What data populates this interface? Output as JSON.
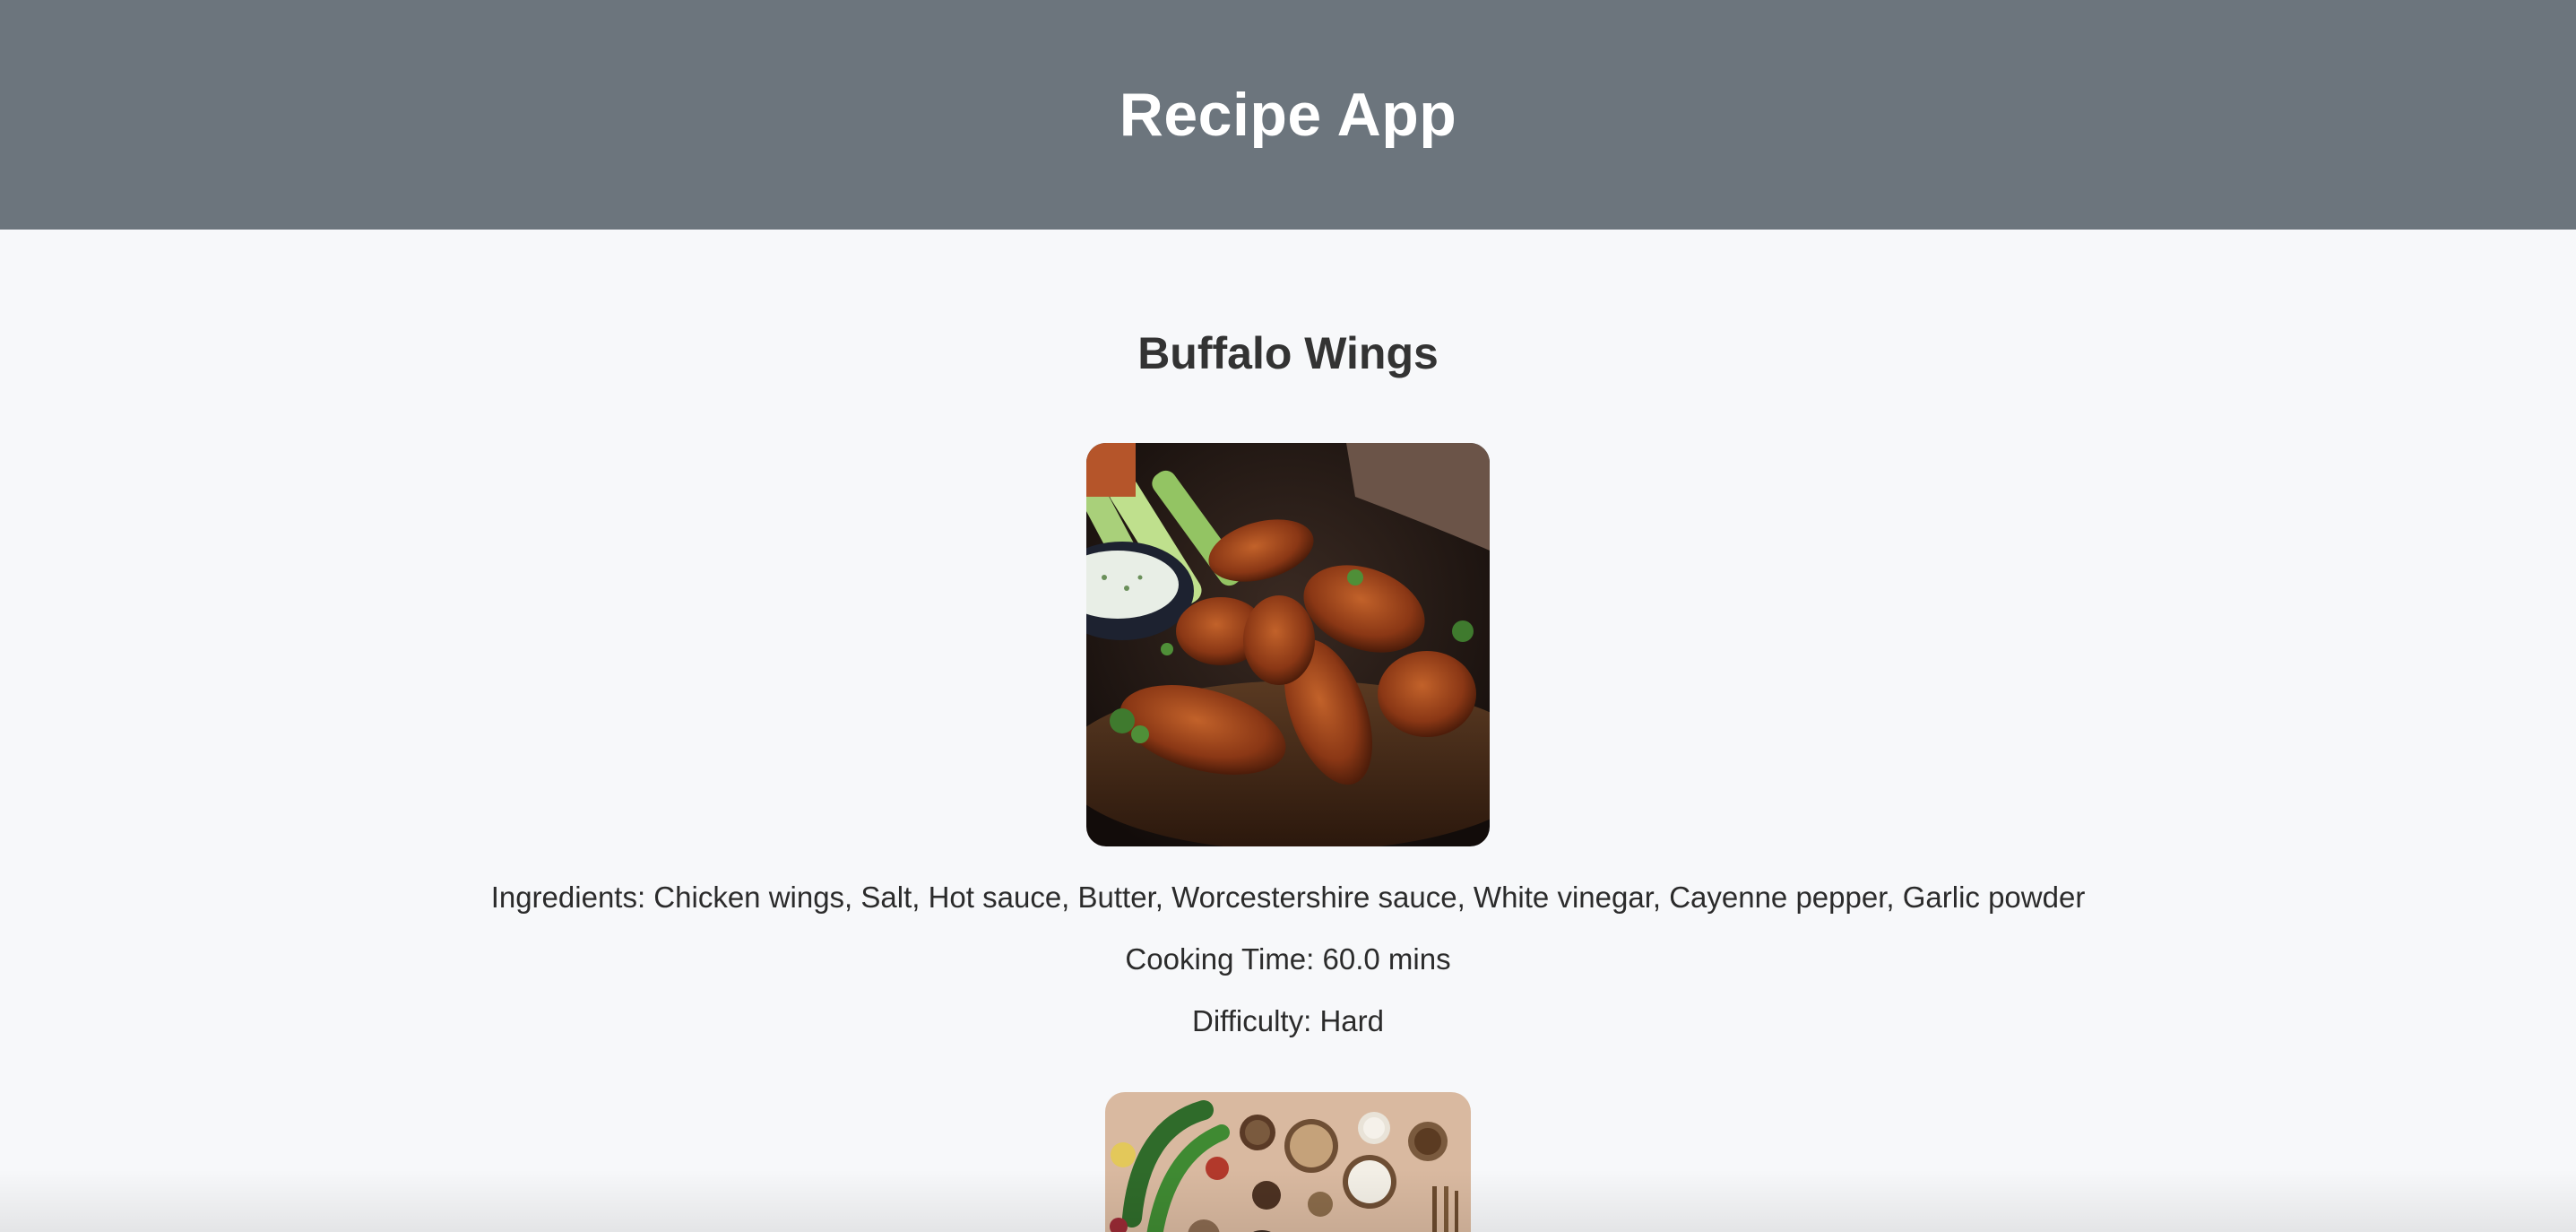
{
  "header": {
    "title": "Recipe App",
    "background": "#6c757d"
  },
  "recipes": [
    {
      "name": "Buffalo Wings",
      "image_icon": "buffalo-wings-photo",
      "ingredients": "Ingredients: Chicken wings, Salt, Hot sauce, Butter, Worcestershire sauce, White vinegar, Cayenne pepper, Garlic powder",
      "cooking_time": "Cooking Time: 60.0 mins",
      "difficulty": "Difficulty: Hard"
    },
    {
      "image_icon": "ingredients-flatlay-photo"
    }
  ],
  "colors": {
    "page_background": "#f7f8fa",
    "text": "#2b2b2b"
  }
}
